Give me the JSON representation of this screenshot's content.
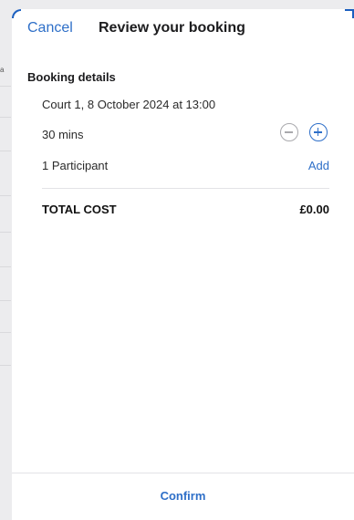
{
  "header": {
    "cancel_label": "Cancel",
    "title": "Review your booking"
  },
  "booking": {
    "section_title": "Booking details",
    "court_line": "Court 1, 8 October 2024 at 13:00",
    "duration": "30 mins",
    "participants": "1 Participant",
    "add_label": "Add",
    "total_label": "TOTAL COST",
    "total_value": "£0.00"
  },
  "footer": {
    "confirm_label": "Confirm"
  },
  "colors": {
    "accent": "#2e6fc8",
    "text": "#1c1c1e",
    "muted_control": "#a9a9ad",
    "divider": "#e3e3e6"
  },
  "icons": {
    "decrement": "minus-circle-icon",
    "increment": "plus-circle-icon"
  }
}
